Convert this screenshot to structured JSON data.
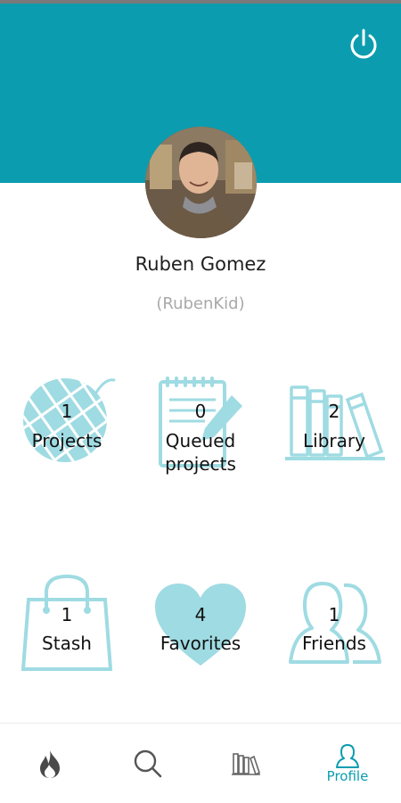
{
  "profile": {
    "name": "Ruben Gomez",
    "username": "(RubenKid)"
  },
  "stats": {
    "projects": {
      "count": "1",
      "label": "Projects",
      "icon": "yarn-ball-icon"
    },
    "queued": {
      "count": "0",
      "label_line1": "Queued",
      "label_line2": "projects",
      "icon": "notepad-pencil-icon"
    },
    "library": {
      "count": "2",
      "label": "Library",
      "icon": "books-icon"
    },
    "stash": {
      "count": "1",
      "label": "Stash",
      "icon": "shopping-bag-icon"
    },
    "favorites": {
      "count": "4",
      "label": "Favorites",
      "icon": "heart-icon"
    },
    "friends": {
      "count": "1",
      "label": "Friends",
      "icon": "people-icon"
    }
  },
  "nav": {
    "items": [
      {
        "icon": "flame-icon",
        "label": ""
      },
      {
        "icon": "search-icon",
        "label": ""
      },
      {
        "icon": "books-icon",
        "label": ""
      },
      {
        "icon": "profile-icon",
        "label": "Profile",
        "active": true
      }
    ]
  },
  "colors": {
    "accent": "#0b9daf",
    "icon_tint": "#9fdbe2",
    "muted_text": "#a9a9a9"
  }
}
